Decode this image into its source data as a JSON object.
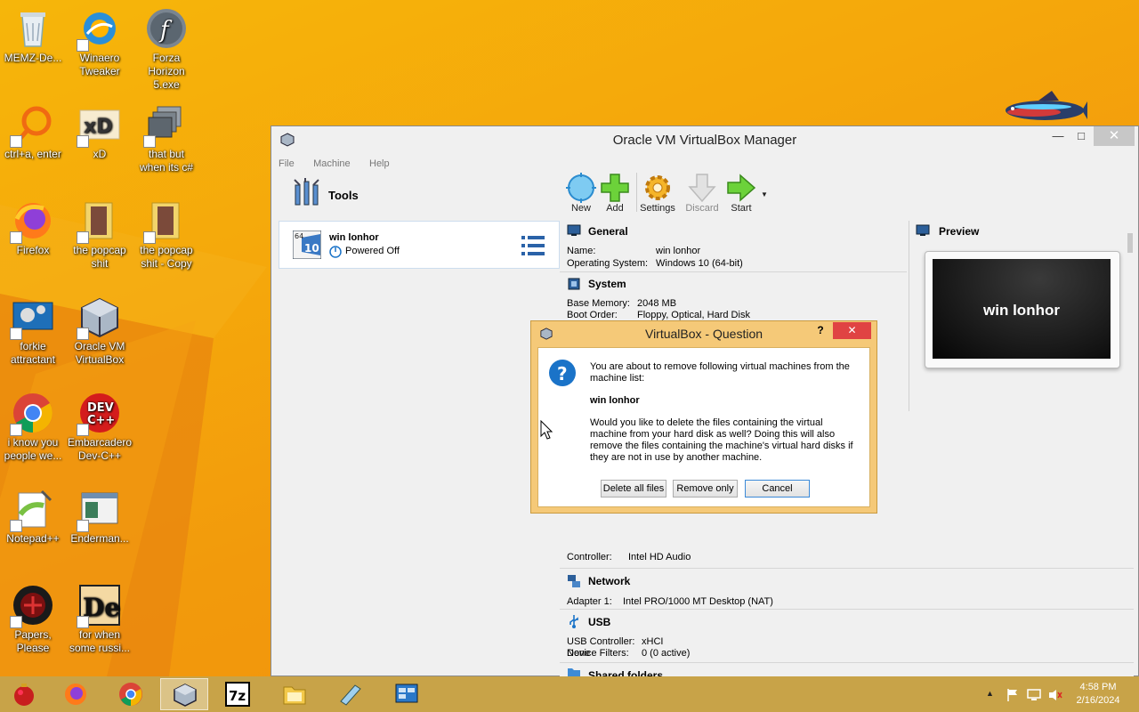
{
  "desktop": {
    "icons": [
      {
        "label1": "MEMZ-De...",
        "label2": "",
        "icon": "recycle-bin-icon"
      },
      {
        "label1": "Winaero",
        "label2": "Tweaker",
        "icon": "winaero-icon"
      },
      {
        "label1": "Forza",
        "label2": "Horizon 5.exe",
        "icon": "flash-icon"
      },
      {
        "label1": "ctrl+a, enter",
        "label2": "",
        "icon": "magnifier-icon"
      },
      {
        "label1": "xD",
        "label2": "",
        "icon": "xd-icon"
      },
      {
        "label1": "that but",
        "label2": "when its c#",
        "icon": "stack-icon"
      },
      {
        "label1": "Firefox",
        "label2": "",
        "icon": "firefox-icon"
      },
      {
        "label1": "the popcap",
        "label2": "shit",
        "icon": "folder-icon"
      },
      {
        "label1": "the popcap",
        "label2": "shit - Copy",
        "icon": "folder-icon"
      },
      {
        "label1": "forkie",
        "label2": "attractant",
        "icon": "control-panel-icon"
      },
      {
        "label1": "Oracle VM",
        "label2": "VirtualBox",
        "icon": "virtualbox-icon"
      },
      {
        "label1": "i know you",
        "label2": "people we...",
        "icon": "chrome-icon"
      },
      {
        "label1": "Embarcadero",
        "label2": "Dev-C++",
        "icon": "devcpp-icon"
      },
      {
        "label1": "Notepad++",
        "label2": "",
        "icon": "notepadpp-icon"
      },
      {
        "label1": "Enderman...",
        "label2": "",
        "icon": "window-app-icon"
      },
      {
        "label1": "Papers,",
        "label2": "Please",
        "icon": "papers-please-icon"
      },
      {
        "label1": "for when",
        "label2": "some russi...",
        "icon": "de-icon"
      }
    ],
    "devcpp_badge": "DEV\nC++",
    "xd_text": "xD",
    "de_text": "De"
  },
  "vbox": {
    "title": "Oracle VM VirtualBox Manager",
    "menu": [
      "File",
      "Machine",
      "Help"
    ],
    "tools_label": "Tools",
    "vm_name": "win lonhor",
    "vm_state": "Powered Off",
    "vm_os_badge_top": "64",
    "vm_os_badge_num": "10",
    "toolbar": {
      "new": "New",
      "add": "Add",
      "settings": "Settings",
      "discard": "Discard",
      "start": "Start"
    },
    "general": {
      "head": "General",
      "name_label": "Name:",
      "name_value": "win lonhor",
      "os_label": "Operating System:",
      "os_value": "Windows 10 (64-bit)"
    },
    "system": {
      "head": "System",
      "mem_label": "Base Memory:",
      "mem_value": "2048 MB",
      "boot_label": "Boot Order:",
      "boot_value": "Floppy, Optical, Hard Disk"
    },
    "audio": {
      "ctrl_label": "Controller:",
      "ctrl_value": "Intel HD Audio"
    },
    "network": {
      "head": "Network",
      "adapter_label": "Adapter 1:",
      "adapter_value": "Intel PRO/1000 MT Desktop (NAT)"
    },
    "usb": {
      "head": "USB",
      "ctrl_label": "USB Controller:",
      "ctrl_value": "xHCI",
      "filters_label": "Device Filters:",
      "filters_value": "0 (0 active)"
    },
    "shared": {
      "head": "Shared folders",
      "value": "None"
    },
    "preview": {
      "head": "Preview",
      "screen_text": "win lonhor"
    }
  },
  "dialog": {
    "title": "VirtualBox - Question",
    "help": "?",
    "line1": "You are about to remove following virtual machines from the",
    "line2": "machine list:",
    "vm": "win lonhor",
    "p1": "Would you like to delete the files containing the virtual",
    "p2": "machine from your hard disk as well? Doing this will also",
    "p3": "remove the files containing the machine's virtual hard disks if",
    "p4": "they are not in use by another machine.",
    "btn_delete": "Delete all files",
    "btn_remove": "Remove only",
    "btn_cancel": "Cancel"
  },
  "taskbar": {
    "time": "4:58 PM",
    "date": "2/16/2024",
    "sevenzip": "7z"
  },
  "colors": {
    "desktop": "#f5a70b",
    "taskbar": "#c8a348",
    "dialog_frame": "#f5c978",
    "close_red": "#e04343",
    "accent_blue": "#1a73c8"
  }
}
